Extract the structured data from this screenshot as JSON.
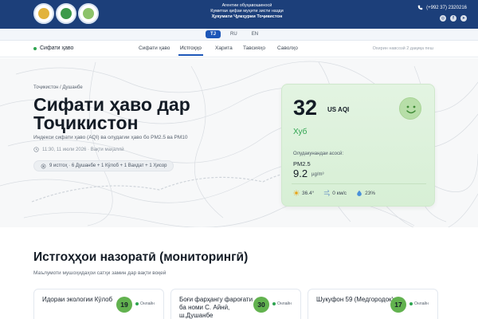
{
  "header": {
    "agency_lines": [
      "Агентии обуҳавошиносӣ",
      "Кумитаи ҳифзи муҳити зисти назди",
      "Ҳукумати Ҷумҳурии Тоҷикистон"
    ],
    "phone": "(+992 37) 2320216",
    "social": [
      "instagram-icon",
      "facebook-icon",
      "telegram-icon"
    ]
  },
  "languages": [
    {
      "label": "TJ",
      "active": true
    },
    {
      "label": "RU",
      "active": false
    },
    {
      "label": "EN",
      "active": false
    }
  ],
  "nav": {
    "brand": "Сифати ҳаво",
    "items": [
      {
        "label": "Сифати ҳаво",
        "active": false
      },
      {
        "label": "Истгоҳҳо",
        "active": true
      },
      {
        "label": "Харита",
        "active": false
      },
      {
        "label": "Тавсияҳо",
        "active": false
      },
      {
        "label": "Саволҳо",
        "active": false
      }
    ],
    "updated": "Охирин навсозӣ 2 дақиқа пеш"
  },
  "hero": {
    "breadcrumb": "Тоҷикистон / Душанбе",
    "title_line1": "Сифати ҳаво дар",
    "title_line2": "Тоҷикистон",
    "subtitle": "Индекси сифати ҳаво (AQI) ва олудагии ҳаво бо PM2.5 ва PM10",
    "timestamp": "11:30, 11 июли 2026 · Вақти маҳаллӣ",
    "stations_summary": "9 истгоҳ · 6 Душанбе + 1 Кӯлоб + 1 Вахдат + 1 Ҳисор"
  },
  "aqi_card": {
    "value": "32",
    "unit": "US AQI",
    "status": "Хуб",
    "pollutant_label": "Олудакунандаи асосӣ:",
    "pollutant": "PM2.5",
    "pollutant_value": "9.2",
    "pollutant_unit": "µg/m³",
    "temperature": "36.4°",
    "wind": "0 км/с",
    "humidity": "23%",
    "accent": "#2ea44f"
  },
  "section": {
    "title": "Истгоҳҳои назоратӣ (мониторингӣ)",
    "subtitle": "Маълумоти мушоҳидаҳои сатҳи замин дар вақти воқеӣ"
  },
  "stations": [
    {
      "name": "Идораи экологии Кӯлоб",
      "aqi": "19",
      "status": "Онлайн"
    },
    {
      "name": "Боғи фарҳангу фароғати ба номи С. Айнӣ, ш.Душанбе",
      "aqi": "30",
      "status": "Онлайн"
    },
    {
      "name": "Шукуфон 59 (Медгородок)",
      "aqi": "17",
      "status": "Онлайн"
    }
  ]
}
